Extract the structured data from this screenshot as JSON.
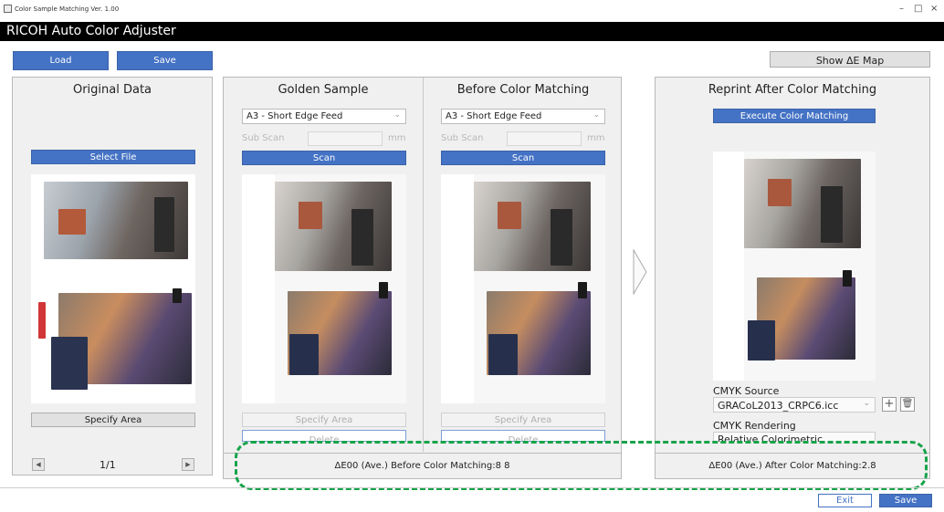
{
  "window": {
    "title": "Color Sample Matching Ver. 1.00",
    "minimize": "–",
    "maximize": "□",
    "close": "×"
  },
  "app": {
    "name": "RICOH Auto Color Adjuster"
  },
  "toolbar": {
    "load": "Load",
    "save": "Save",
    "show_map": "Show ΔE Map"
  },
  "original": {
    "title": "Original Data",
    "select_file": "Select File",
    "specify_area": "Specify Area",
    "page": "1/1",
    "prev": "◀",
    "next": "▶"
  },
  "golden": {
    "title": "Golden Sample",
    "paper_size": "A3 - Short Edge Feed",
    "sub_scan_label": "Sub Scan",
    "sub_scan_unit": "mm",
    "scan": "Scan",
    "specify_area": "Specify Area",
    "delete": "Delete"
  },
  "before": {
    "title": "Before Color Matching",
    "paper_size": "A3 - Short Edge Feed",
    "sub_scan_label": "Sub Scan",
    "sub_scan_unit": "mm",
    "scan": "Scan",
    "specify_area": "Specify Area",
    "delete": "Delete"
  },
  "reprint": {
    "title": "Reprint After Color Matching",
    "execute": "Execute Color Matching",
    "cmyk_source_label": "CMYK Source",
    "cmyk_source_value": "GRACoL2013_CRPC6.icc",
    "cmyk_rendering_label": "CMYK Rendering",
    "cmyk_rendering_value": "Relative Colorimetric"
  },
  "status": {
    "before": "ΔE00 (Ave.) Before Color Matching:8 8",
    "after": "ΔE00 (Ave.) After Color Matching:2.8"
  },
  "footer": {
    "exit": "Exit",
    "save": "Save"
  },
  "colors": {
    "accent_blue": "#4472c4",
    "highlight_green": "#16a34a",
    "banner_black": "#000000"
  }
}
